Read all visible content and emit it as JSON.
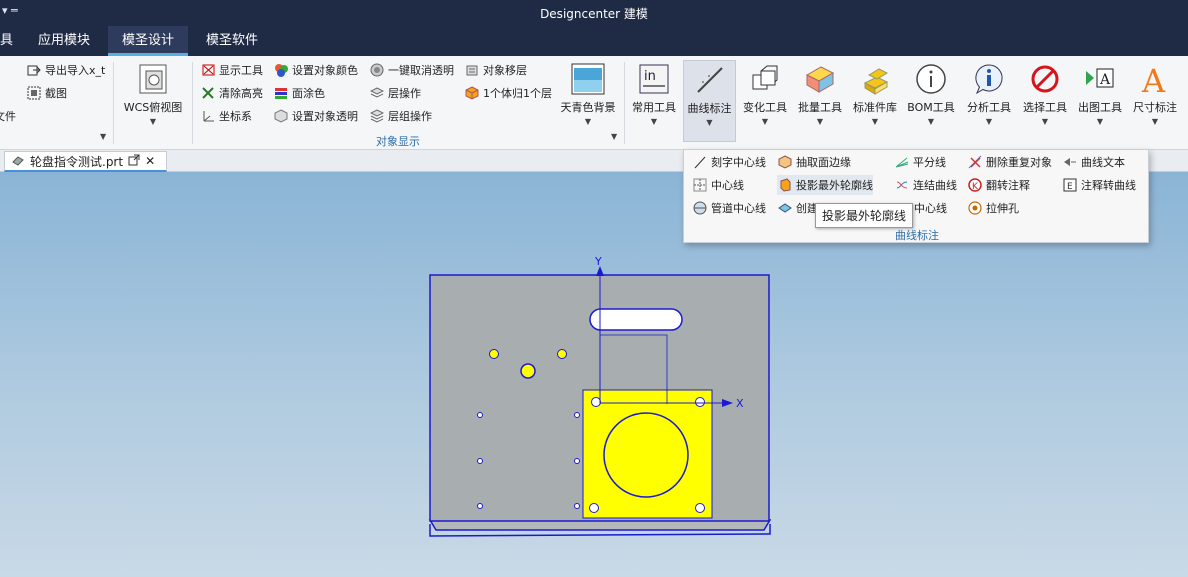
{
  "window": {
    "qat": "▾ ═",
    "title": "Designcenter 建模"
  },
  "menu": {
    "tabs": [
      {
        "label": "具"
      },
      {
        "label": "应用模块"
      },
      {
        "label": "模圣设计"
      },
      {
        "label": "模圣软件"
      }
    ]
  },
  "ribbon": {
    "file_group": {
      "export_xt": "导出导入x_t",
      "screenshot": "截图",
      "file_label": "文件"
    },
    "wcs": {
      "label": "WCS俯视图"
    },
    "display_group": {
      "label": "对象显示",
      "show_tools": "显示工具",
      "set_color": "设置对象颜色",
      "cancel_transparent": "一键取消透明",
      "move_object": "对象移层",
      "clear_highlight": "清除高亮",
      "face_paint": "面涂色",
      "layer_op": "层操作",
      "one_body_layer": "1个体归1个层",
      "coord_sys": "坐标系",
      "set_transparent": "设置对象透明",
      "layer_group_op": "层组操作",
      "sky_bg": "天青色背景"
    },
    "big_buttons": [
      {
        "label": "常用工具"
      },
      {
        "label": "曲线标注"
      },
      {
        "label": "变化工具"
      },
      {
        "label": "批量工具"
      },
      {
        "label": "标准件库"
      },
      {
        "label": "BOM工具"
      },
      {
        "label": "分析工具"
      },
      {
        "label": "选择工具"
      },
      {
        "label": "出图工具"
      },
      {
        "label": "尺寸标注"
      }
    ]
  },
  "doc": {
    "tab_label": "轮盘指令测试.prt",
    "close": "✕"
  },
  "dropdown": {
    "group_label": "曲线标注",
    "items": {
      "engrave_centerline": "刻字中心线",
      "extract_face_edge": "抽取面边缘",
      "bisector": "平分线",
      "delete_duplicate": "删除重复对象",
      "curve_text": "曲线文本",
      "centerline": "中心线",
      "project_outline": "投影最外轮廓线",
      "join_curves": "连结曲线",
      "flip_annotation": "翻转注释",
      "annotation_to_curve": "注释转曲线",
      "pipe_centerline": "管道中心线",
      "create": "创建",
      "centerline2": "中心线",
      "extrude_hole": "拉伸孔"
    },
    "tooltip": "投影最外轮廓线"
  },
  "viewport": {
    "axis_x": "X",
    "axis_y": "Y",
    "colors": {
      "plate": "#a8adb0",
      "edge": "#1a1ad0",
      "highlight": "#ffff00"
    }
  }
}
